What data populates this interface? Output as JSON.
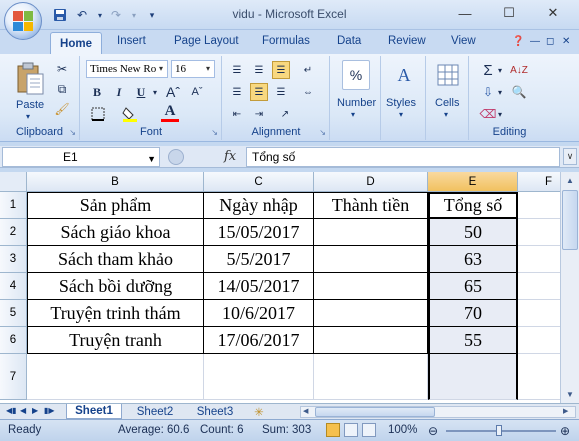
{
  "window": {
    "title": "vidu - Microsoft Excel",
    "controls": [
      "—",
      "☐",
      "✕"
    ]
  },
  "ribbon": {
    "tabs": [
      "Home",
      "Insert",
      "Page Layout",
      "Formulas",
      "Data",
      "Review",
      "View"
    ],
    "groups": {
      "clipboard": {
        "label": "Clipboard",
        "paste": "Paste"
      },
      "font": {
        "label": "Font",
        "font_name": "Times New Ro",
        "font_size": "16"
      },
      "alignment": {
        "label": "Alignment"
      },
      "number": {
        "label": "Number",
        "icon_text": "%"
      },
      "styles": {
        "label": "Styles",
        "icon_text": "A"
      },
      "cells": {
        "label": "Cells"
      },
      "editing": {
        "label": "Editing"
      }
    },
    "font_buttons": [
      "B",
      "I",
      "U",
      "A"
    ]
  },
  "formula_bar": {
    "name_box": "E1",
    "fx": "fx",
    "content": "Tổng số"
  },
  "columns": [
    "B",
    "C",
    "D",
    "E",
    "F"
  ],
  "rows": [
    "1",
    "2",
    "3",
    "4",
    "5",
    "6",
    "7"
  ],
  "table": {
    "headers": [
      "Sản phẩm",
      "Ngày nhập",
      "Thành tiền",
      "Tổng số"
    ],
    "rows": [
      [
        "Sách giáo khoa",
        "15/05/2017",
        "",
        "50"
      ],
      [
        "Sách tham khảo",
        "5/5/2017",
        "",
        "63"
      ],
      [
        "Sách bồi dưỡng",
        "14/05/2017",
        "",
        "65"
      ],
      [
        "Truyện trinh thám",
        "10/6/2017",
        "",
        "70"
      ],
      [
        "Truyện tranh",
        "17/06/2017",
        "",
        "55"
      ]
    ]
  },
  "sheet_tabs": [
    "Sheet1",
    "Sheet2",
    "Sheet3"
  ],
  "status": {
    "ready": "Ready",
    "average": "Average: 60.6",
    "count": "Count: 6",
    "sum": "Sum: 303",
    "zoom": "100%"
  },
  "colors": {
    "office_logo": [
      "#e2583e",
      "#7fba42",
      "#2d8ad8",
      "#f5b700"
    ],
    "selection": "#f1c15f"
  }
}
